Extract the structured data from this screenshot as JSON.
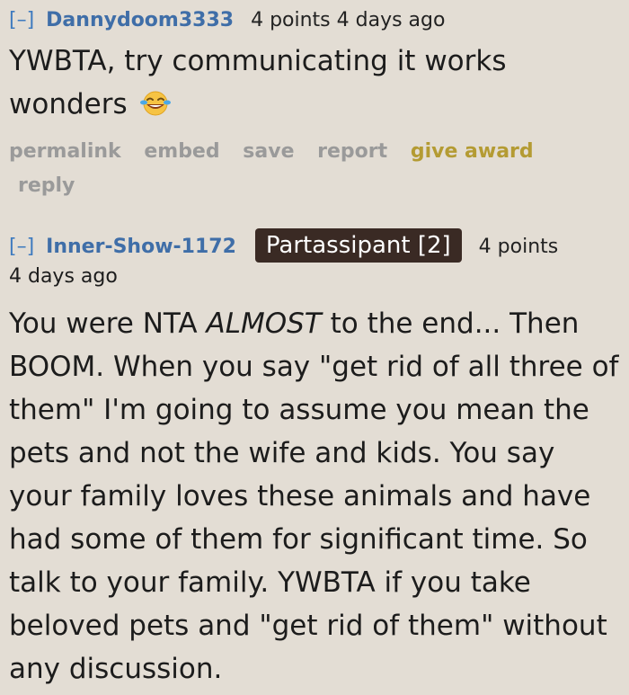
{
  "comments": [
    {
      "expand": "[–]",
      "author": "Dannydoom3333",
      "meta": "4 points 4 days ago",
      "body_text": "YWBTA, try communicating it works wonders",
      "emoji_icon": "rolling-laughing-emoji",
      "buttons": {
        "permalink": "permalink",
        "embed": "embed",
        "save": "save",
        "report": "report",
        "give_award": "give award",
        "reply": "reply"
      },
      "colors": {
        "author": "#3f6ea8",
        "award": "#b49b33"
      }
    },
    {
      "expand": "[–]",
      "author": "Inner-Show-1172",
      "flair": "Partassipant [2]",
      "points": "4 points",
      "date": "4 days ago",
      "body": {
        "part1": "You were NTA ",
        "emph": "ALMOST",
        "part2": " to the end... Then BOOM. When you say \"get rid of all three of them\" I'm going to assume you mean the pets and not the wife and kids. You say your family loves these animals and have had some of them for significant time. So talk to your family. YWBTA if you take beloved pets and \"get rid of them\" without any discussion."
      },
      "colors": {
        "flair_bg": "#3a2a24",
        "author": "#3f6ea8"
      }
    }
  ]
}
